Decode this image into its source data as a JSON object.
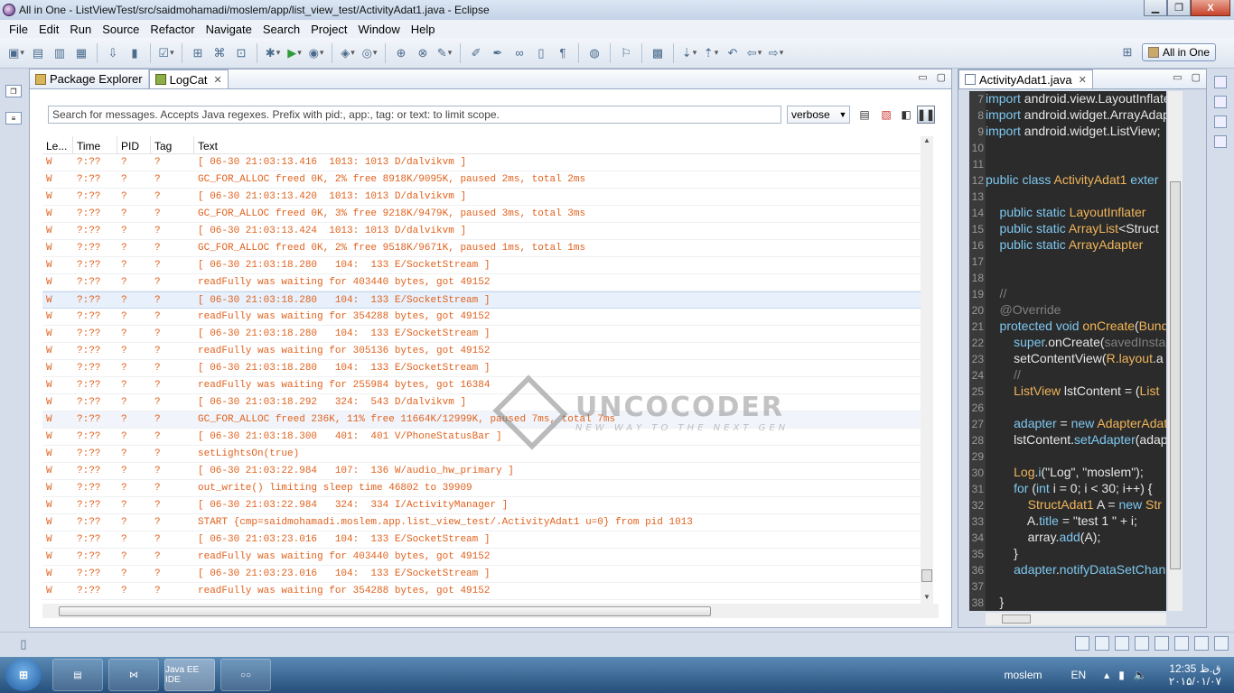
{
  "window": {
    "title": "All in One - ListViewTest/src/saidmohamadi/moslem/app/list_view_test/ActivityAdat1.java - Eclipse",
    "min_label": "▁",
    "max_label": "❐",
    "close_label": "X"
  },
  "menu": [
    "File",
    "Edit",
    "Run",
    "Source",
    "Refactor",
    "Navigate",
    "Search",
    "Project",
    "Window",
    "Help"
  ],
  "perspective": {
    "label": "All in One"
  },
  "left_view": {
    "tabs": [
      {
        "label": "Package Explorer"
      },
      {
        "label": "LogCat"
      }
    ],
    "search_placeholder": "Search for messages. Accepts Java regexes. Prefix with pid:, app:, tag: or text: to limit scope.",
    "level_select": "verbose",
    "columns": [
      "Le...",
      "Time",
      "PID",
      "Tag",
      "Text"
    ],
    "rows": [
      [
        "W",
        "?:??",
        "?",
        "?",
        "[ 06-30 21:03:13.416  1013: 1013 D/dalvikvm ]"
      ],
      [
        "W",
        "?:??",
        "?",
        "?",
        "GC_FOR_ALLOC freed 0K, 2% free 8918K/9095K, paused 2ms, total 2ms"
      ],
      [
        "W",
        "?:??",
        "?",
        "?",
        "[ 06-30 21:03:13.420  1013: 1013 D/dalvikvm ]"
      ],
      [
        "W",
        "?:??",
        "?",
        "?",
        "GC_FOR_ALLOC freed 0K, 3% free 9218K/9479K, paused 3ms, total 3ms"
      ],
      [
        "W",
        "?:??",
        "?",
        "?",
        "[ 06-30 21:03:13.424  1013: 1013 D/dalvikvm ]"
      ],
      [
        "W",
        "?:??",
        "?",
        "?",
        "GC_FOR_ALLOC freed 0K, 2% free 9518K/9671K, paused 1ms, total 1ms"
      ],
      [
        "W",
        "?:??",
        "?",
        "?",
        "[ 06-30 21:03:18.280   104:  133 E/SocketStream ]"
      ],
      [
        "W",
        "?:??",
        "?",
        "?",
        "readFully was waiting for 403440 bytes, got 49152"
      ],
      [
        "W",
        "?:??",
        "?",
        "?",
        "[ 06-30 21:03:18.280   104:  133 E/SocketStream ]"
      ],
      [
        "W",
        "?:??",
        "?",
        "?",
        "readFully was waiting for 354288 bytes, got 49152"
      ],
      [
        "W",
        "?:??",
        "?",
        "?",
        "[ 06-30 21:03:18.280   104:  133 E/SocketStream ]"
      ],
      [
        "W",
        "?:??",
        "?",
        "?",
        "readFully was waiting for 305136 bytes, got 49152"
      ],
      [
        "W",
        "?:??",
        "?",
        "?",
        "[ 06-30 21:03:18.280   104:  133 E/SocketStream ]"
      ],
      [
        "W",
        "?:??",
        "?",
        "?",
        "readFully was waiting for 255984 bytes, got 16384"
      ],
      [
        "W",
        "?:??",
        "?",
        "?",
        "[ 06-30 21:03:18.292   324:  543 D/dalvikvm ]"
      ],
      [
        "W",
        "?:??",
        "?",
        "?",
        "GC_FOR_ALLOC freed 236K, 11% free 11664K/12999K, paused 7ms, total 7ms"
      ],
      [
        "W",
        "?:??",
        "?",
        "?",
        "[ 06-30 21:03:18.300   401:  401 V/PhoneStatusBar ]"
      ],
      [
        "W",
        "?:??",
        "?",
        "?",
        "setLightsOn(true)"
      ],
      [
        "W",
        "?:??",
        "?",
        "?",
        "[ 06-30 21:03:22.984   107:  136 W/audio_hw_primary ]"
      ],
      [
        "W",
        "?:??",
        "?",
        "?",
        "out_write() limiting sleep time 46802 to 39909"
      ],
      [
        "W",
        "?:??",
        "?",
        "?",
        "[ 06-30 21:03:22.984   324:  334 I/ActivityManager ]"
      ],
      [
        "W",
        "?:??",
        "?",
        "?",
        "START {cmp=saidmohamadi.moslem.app.list_view_test/.ActivityAdat1 u=0} from pid 1013"
      ],
      [
        "W",
        "?:??",
        "?",
        "?",
        "[ 06-30 21:03:23.016   104:  133 E/SocketStream ]"
      ],
      [
        "W",
        "?:??",
        "?",
        "?",
        "readFully was waiting for 403440 bytes, got 49152"
      ],
      [
        "W",
        "?:??",
        "?",
        "?",
        "[ 06-30 21:03:23.016   104:  133 E/SocketStream ]"
      ],
      [
        "W",
        "?:??",
        "?",
        "?",
        "readFully was waiting for 354288 bytes, got 49152"
      ]
    ]
  },
  "watermark": {
    "main": "UNCOCODER",
    "sub": "NEW WAY TO THE NEXT GEN"
  },
  "editor": {
    "tab": "ActivityAdat1.java",
    "lines": [
      {
        "n": "7",
        "parts": [
          [
            "kw",
            "import"
          ],
          [
            "tx",
            " android.view.LayoutInflate"
          ]
        ]
      },
      {
        "n": "8",
        "parts": [
          [
            "kw",
            "import"
          ],
          [
            "tx",
            " android.widget.ArrayAdap"
          ]
        ]
      },
      {
        "n": "9",
        "parts": [
          [
            "kw",
            "import"
          ],
          [
            "tx",
            " android.widget.ListView;"
          ]
        ]
      },
      {
        "n": "10",
        "parts": []
      },
      {
        "n": "11",
        "parts": []
      },
      {
        "n": "12",
        "parts": [
          [
            "kw",
            "public class "
          ],
          [
            "type",
            "ActivityAdat1"
          ],
          [
            "kw",
            " exter"
          ]
        ]
      },
      {
        "n": "13",
        "parts": []
      },
      {
        "n": "14",
        "parts": [
          [
            "kw",
            "    public static "
          ],
          [
            "type",
            "LayoutInflater"
          ]
        ]
      },
      {
        "n": "15",
        "parts": [
          [
            "kw",
            "    public static "
          ],
          [
            "type",
            "ArrayList"
          ],
          [
            "tx",
            "<Struct"
          ]
        ]
      },
      {
        "n": "16",
        "parts": [
          [
            "kw",
            "    public static "
          ],
          [
            "type",
            "ArrayAdapter"
          ]
        ]
      },
      {
        "n": "17",
        "parts": []
      },
      {
        "n": "18",
        "parts": []
      },
      {
        "n": "19",
        "parts": [
          [
            "cm",
            "    //"
          ]
        ]
      },
      {
        "n": "20",
        "parts": [
          [
            "cm",
            "    @Override"
          ]
        ]
      },
      {
        "n": "21",
        "parts": [
          [
            "kw",
            "    protected void "
          ],
          [
            "fn",
            "onCreate"
          ],
          [
            "tx",
            "("
          ],
          [
            "type",
            "Bund"
          ]
        ]
      },
      {
        "n": "22",
        "parts": [
          [
            "kw",
            "        super"
          ],
          [
            "tx",
            ".onCreate("
          ],
          [
            "cm",
            "savedInsta"
          ]
        ]
      },
      {
        "n": "23",
        "parts": [
          [
            "tx",
            "        setContentView("
          ],
          [
            "type",
            "R.layout"
          ],
          [
            "tx",
            ".a"
          ]
        ]
      },
      {
        "n": "24",
        "parts": [
          [
            "cm",
            "        //"
          ]
        ]
      },
      {
        "n": "25",
        "parts": [
          [
            "type",
            "        ListView"
          ],
          [
            "tx",
            " lstContent = ("
          ],
          [
            "type",
            "List"
          ]
        ]
      },
      {
        "n": "26",
        "parts": []
      },
      {
        "n": "27",
        "parts": [
          [
            "kw",
            "        adapter"
          ],
          [
            "tx",
            " = "
          ],
          [
            "kw",
            "new "
          ],
          [
            "type",
            "AdapterAdat"
          ]
        ]
      },
      {
        "n": "28",
        "parts": [
          [
            "tx",
            "        lstContent."
          ],
          [
            "kw",
            "setAdapter"
          ],
          [
            "tx",
            "(adap"
          ]
        ]
      },
      {
        "n": "29",
        "parts": []
      },
      {
        "n": "30",
        "parts": [
          [
            "type",
            "        Log"
          ],
          [
            "tx",
            "."
          ],
          [
            "kw",
            "i"
          ],
          [
            "tx",
            "(\"Log\", \"moslem\");"
          ]
        ]
      },
      {
        "n": "31",
        "parts": [
          [
            "kw",
            "        for"
          ],
          [
            "tx",
            " ("
          ],
          [
            "kw",
            "int"
          ],
          [
            "tx",
            " i = 0; i < 30; i++) {"
          ]
        ]
      },
      {
        "n": "32",
        "parts": [
          [
            "type",
            "            StructAdat1"
          ],
          [
            "tx",
            " A = "
          ],
          [
            "kw",
            "new "
          ],
          [
            "type",
            "Str"
          ]
        ]
      },
      {
        "n": "33",
        "parts": [
          [
            "tx",
            "            A."
          ],
          [
            "kw",
            "title"
          ],
          [
            "tx",
            " = \"test 1 \" + i;"
          ]
        ]
      },
      {
        "n": "34",
        "parts": [
          [
            "tx",
            "            array."
          ],
          [
            "kw",
            "add"
          ],
          [
            "tx",
            "(A);"
          ]
        ]
      },
      {
        "n": "35",
        "parts": [
          [
            "tx",
            "        }"
          ]
        ]
      },
      {
        "n": "36",
        "parts": [
          [
            "kw",
            "        adapter"
          ],
          [
            "tx",
            "."
          ],
          [
            "kw",
            "notifyDataSetChan"
          ]
        ]
      },
      {
        "n": "37",
        "parts": []
      },
      {
        "n": "38",
        "parts": [
          [
            "tx",
            "    }"
          ]
        ]
      }
    ]
  },
  "taskbar": {
    "user": "moslem",
    "lang": "EN",
    "time": "12:35 ق.ظ",
    "date": "۲۰۱۵/۰۱/۰۷",
    "eclipse_task": "Java EE IDE"
  }
}
